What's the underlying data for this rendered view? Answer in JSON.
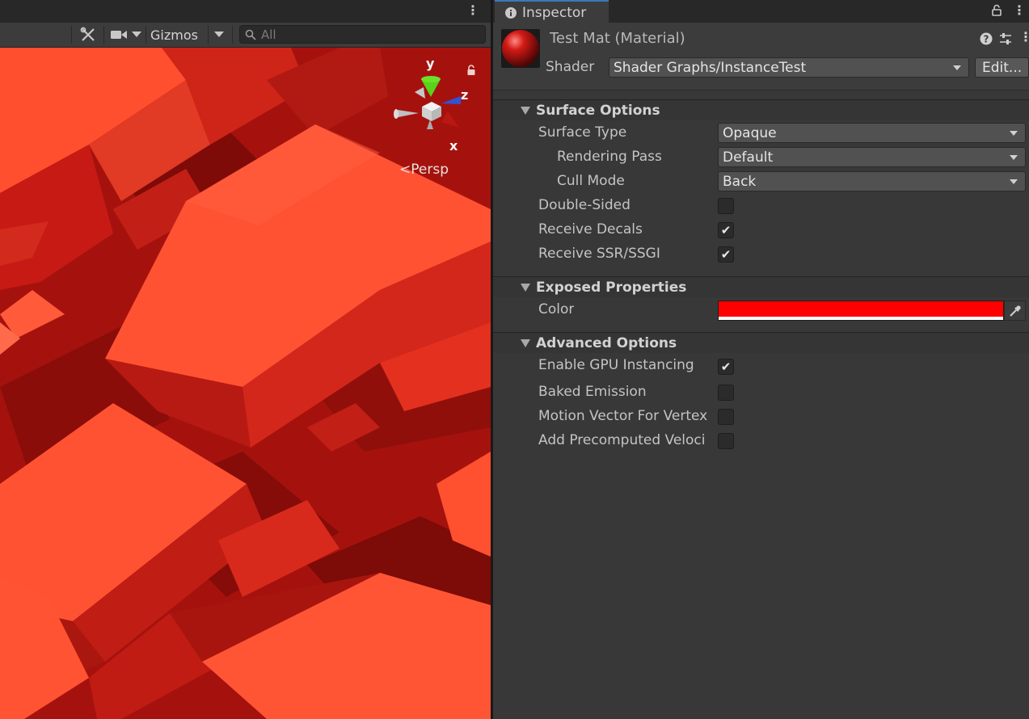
{
  "scene": {
    "toolbar": {
      "gizmos_label": "Gizmos",
      "search_placeholder": "All"
    },
    "view": {
      "projection_label": "Persp",
      "axis_y": "y",
      "axis_z": "z",
      "axis_x": "x"
    }
  },
  "inspector": {
    "tab_label": "Inspector",
    "material": {
      "title": "Test Mat (Material)",
      "shader_label": "Shader",
      "shader_value": "Shader Graphs/InstanceTest",
      "edit_button": "Edit..."
    },
    "sections": {
      "surface": {
        "title": "Surface Options",
        "surface_type": {
          "label": "Surface Type",
          "value": "Opaque"
        },
        "rendering_pass": {
          "label": "Rendering Pass",
          "value": "Default"
        },
        "cull_mode": {
          "label": "Cull Mode",
          "value": "Back"
        },
        "double_sided": {
          "label": "Double-Sided",
          "checked": false
        },
        "receive_decals": {
          "label": "Receive Decals",
          "checked": true
        },
        "receive_ssr": {
          "label": "Receive SSR/SSGI",
          "checked": true
        }
      },
      "exposed": {
        "title": "Exposed Properties",
        "color": {
          "label": "Color",
          "value": "#ff0000"
        }
      },
      "advanced": {
        "title": "Advanced Options",
        "gpu_instancing": {
          "label": "Enable GPU Instancing",
          "checked": true
        },
        "baked_emission": {
          "label": "Baked Emission",
          "checked": false
        },
        "motion_vector": {
          "label": "Motion Vector For Vertex",
          "checked": false
        },
        "precomputed_velocity": {
          "label": "Add Precomputed Veloci",
          "checked": false
        }
      }
    }
  },
  "colors": {
    "accent": "#3a79bb",
    "panel": "#383838",
    "scene_dark": "#b11410",
    "scene_light": "#ff5533"
  }
}
